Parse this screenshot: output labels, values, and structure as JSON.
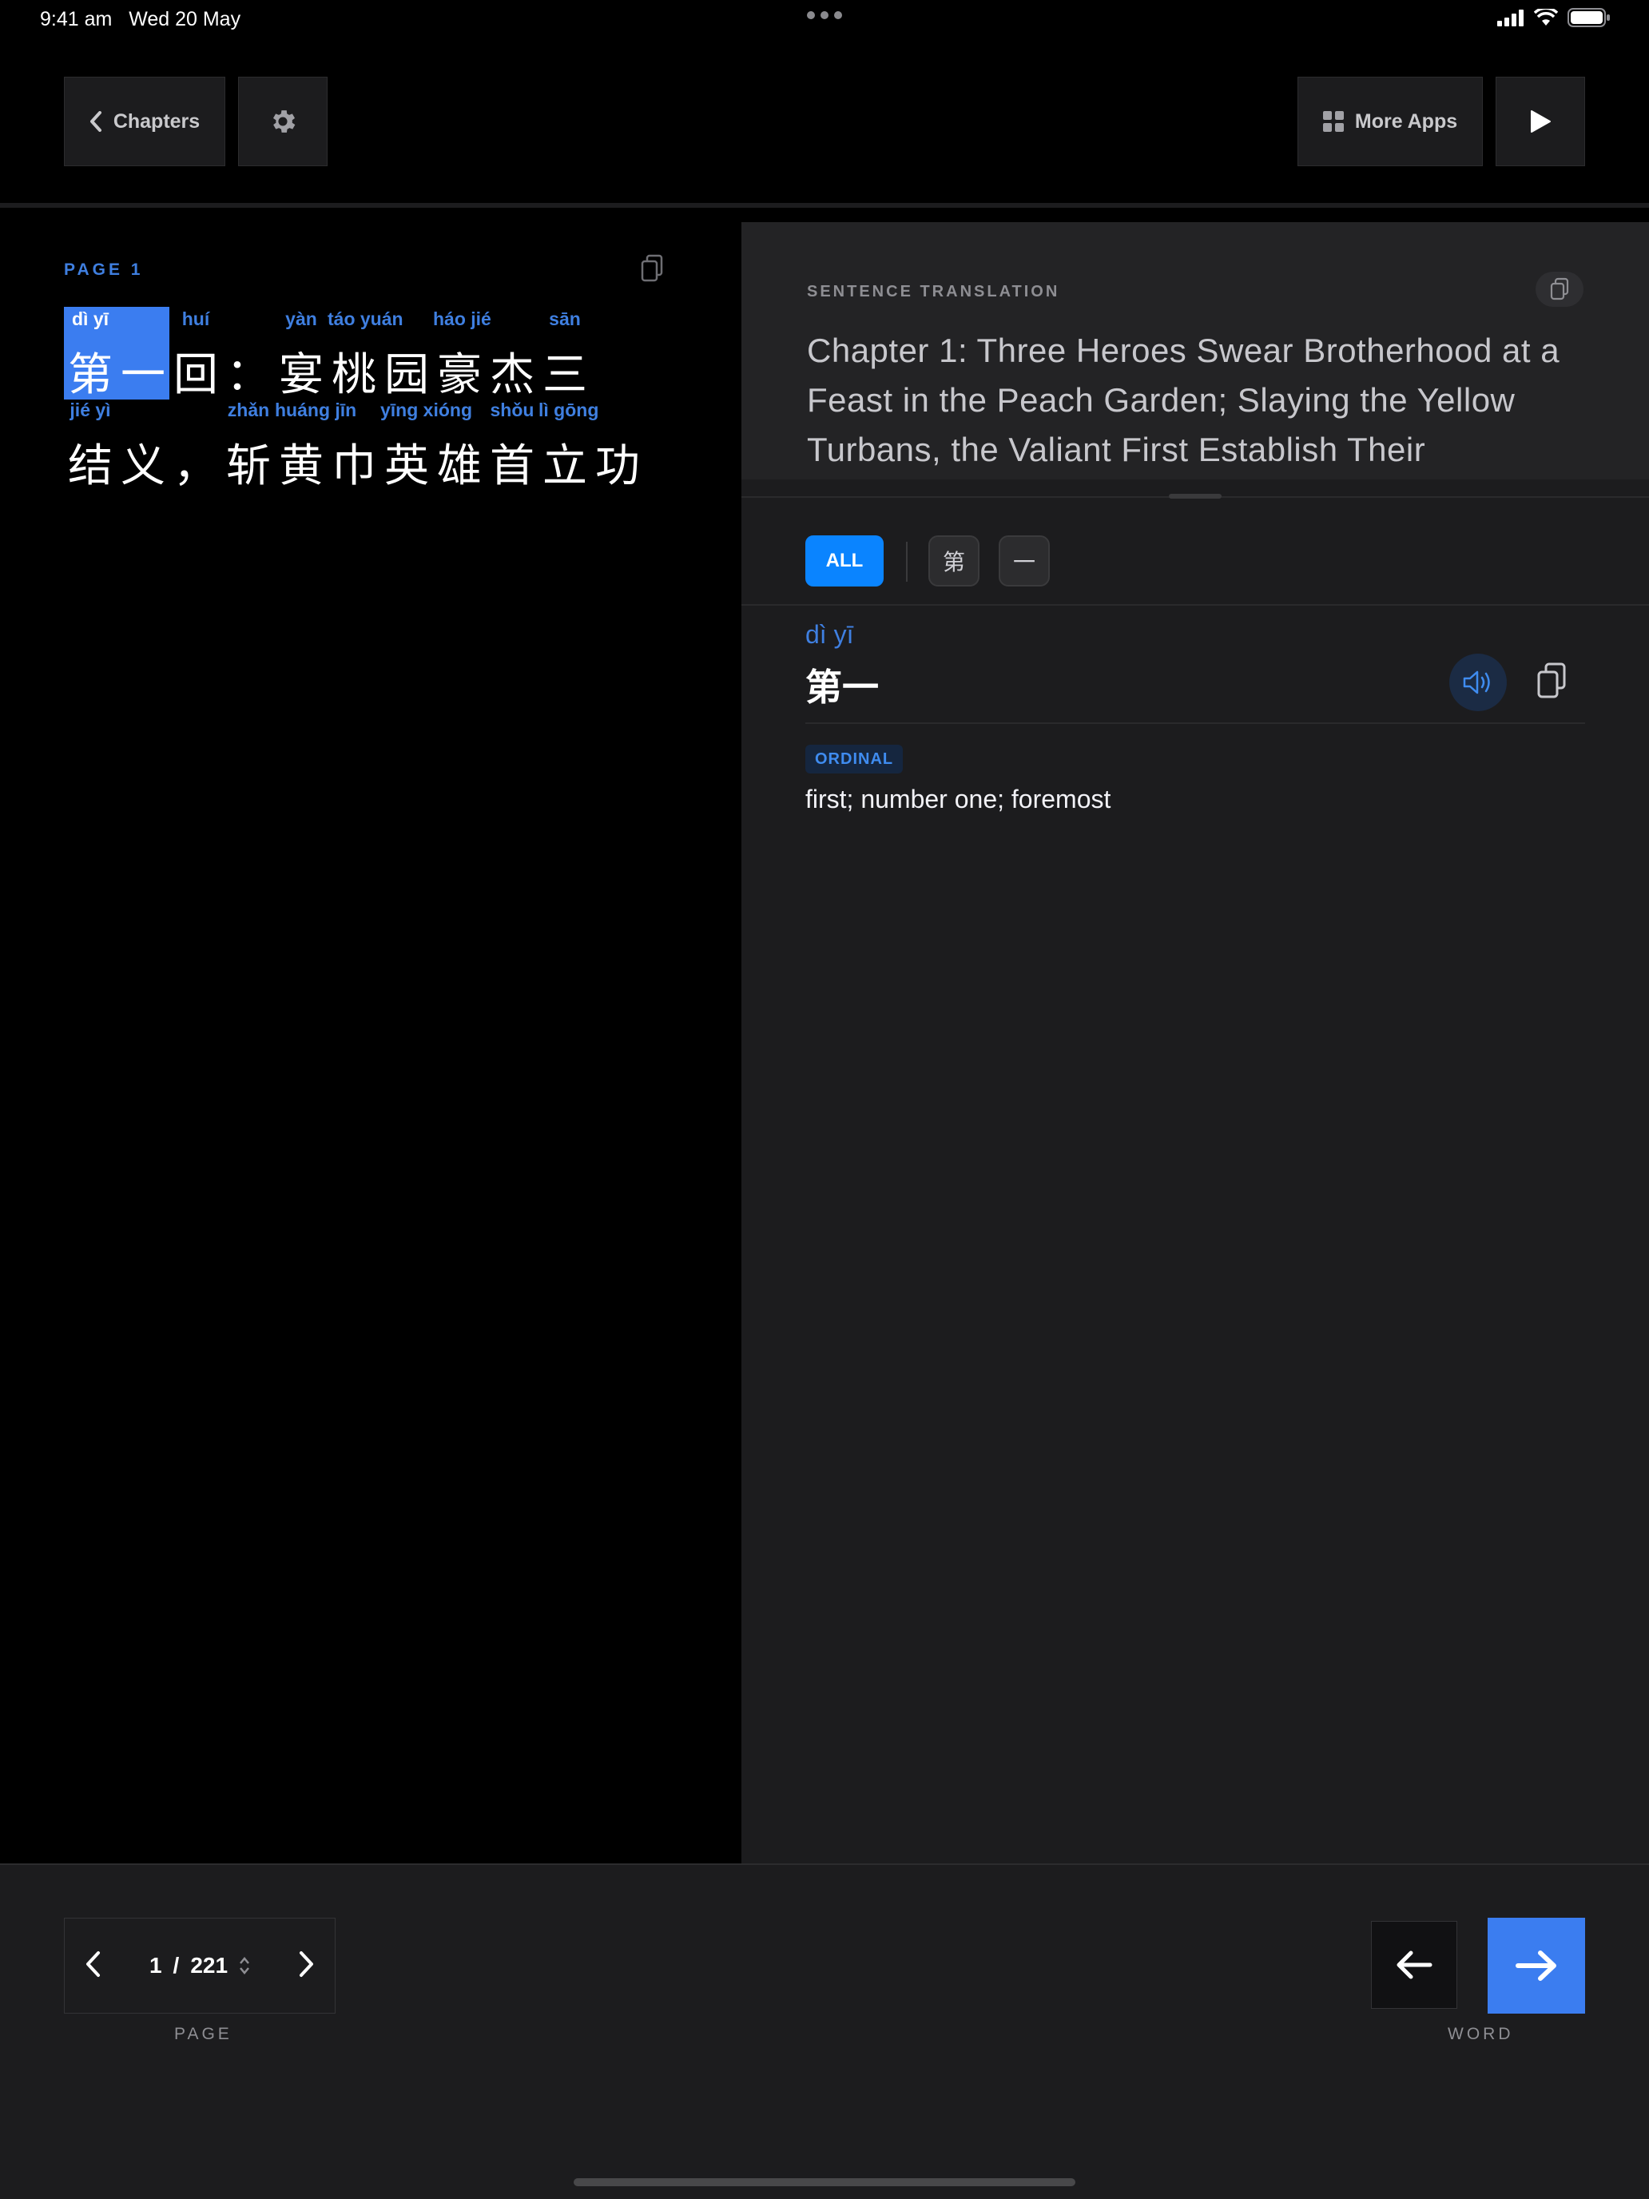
{
  "status_bar": {
    "time": "9:41 am",
    "date": "Wed 20 May"
  },
  "toolbar": {
    "chapters_label": "Chapters",
    "more_apps_label": "More Apps"
  },
  "reader": {
    "page_label": "PAGE  1",
    "line1": [
      {
        "hz": "第",
        "py": "dì yī",
        "selected": true
      },
      {
        "hz": "一",
        "py": "",
        "selected": true
      },
      {
        "hz": "回",
        "py": "huí"
      },
      {
        "hz": "：",
        "py": ""
      },
      {
        "hz": "宴",
        "py": "yàn"
      },
      {
        "hz": "桃",
        "py": "táo yuán"
      },
      {
        "hz": "园",
        "py": ""
      },
      {
        "hz": "豪",
        "py": "háo jié"
      },
      {
        "hz": "杰",
        "py": ""
      },
      {
        "hz": "三",
        "py": "sān"
      }
    ],
    "line2": [
      {
        "hz": "结",
        "py": "jié yì"
      },
      {
        "hz": "义",
        "py": ""
      },
      {
        "hz": "，",
        "py": ""
      },
      {
        "hz": "斩",
        "py": "zhǎn"
      },
      {
        "hz": "黄",
        "py": "huáng jīn"
      },
      {
        "hz": "巾",
        "py": ""
      },
      {
        "hz": "英",
        "py": "yīng xióng"
      },
      {
        "hz": "雄",
        "py": ""
      },
      {
        "hz": "首",
        "py": "shǒu"
      },
      {
        "hz": "立",
        "py": "lì gōng"
      },
      {
        "hz": "功",
        "py": ""
      }
    ]
  },
  "translation": {
    "label": "SENTENCE TRANSLATION",
    "text": "Chapter 1: Three Heroes Swear Brotherhood at a Feast in the Peach Garden; Slaying the Yellow Turbans, the Valiant First Establish Their"
  },
  "filters": {
    "all_label": "ALL",
    "chars": [
      "第",
      "一"
    ]
  },
  "entry": {
    "pinyin": "dì yī",
    "hanzi": "第一",
    "pos": "ORDINAL",
    "gloss": "first; number one; foremost"
  },
  "pager": {
    "current": "1",
    "separator": "/",
    "total": "221",
    "label": "PAGE"
  },
  "word_nav": {
    "label": "WORD"
  },
  "colors": {
    "accent": "#3b7df0",
    "pinyin": "#3f7fe0",
    "panel": "#1c1c1e"
  },
  "icons": [
    "chevron-left-icon",
    "gear-icon",
    "grid-icon",
    "play-icon",
    "copy-icon",
    "speaker-icon",
    "arrow-left-icon",
    "arrow-right-icon"
  ]
}
